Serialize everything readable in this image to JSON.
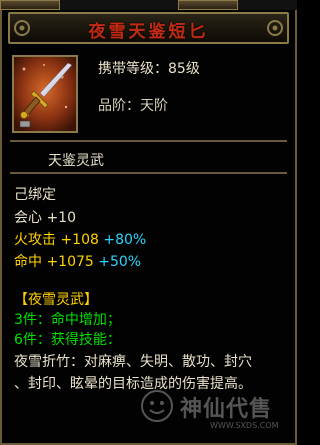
{
  "title": "夜雪天鉴短匕",
  "item": {
    "carry_label": "携带等级：85级",
    "rank_label": "品阶：天阶"
  },
  "set_name": "天鉴灵武",
  "bind_status": "己绑定",
  "stats": [
    {
      "name": "会心",
      "base": "+10",
      "bonus": ""
    },
    {
      "name": "火攻击",
      "base": "+108",
      "bonus": "+80%"
    },
    {
      "name": "命中",
      "base": "+1075",
      "bonus": "+50%"
    }
  ],
  "set_info": {
    "header": "【夜雪灵武】",
    "piece3": "3件：命中增加；",
    "piece6": "6件：获得技能：",
    "skill_line1": "夜雪折竹：对麻痹、失明、散功、封穴",
    "skill_line2": "、封印、眩晕的目标造成的伤害提高。"
  },
  "watermark": {
    "text": "神仙代售",
    "url": "WWW.SXDS.COM"
  },
  "colors": {
    "title_red": "#c22a12",
    "gold": "#ffd100",
    "green": "#00e000",
    "cyan": "#2ad4ff",
    "border": "#8a7a4a"
  },
  "icons": [
    "dagger-icon",
    "title-ornament-icon",
    "sxds-logo-icon"
  ]
}
